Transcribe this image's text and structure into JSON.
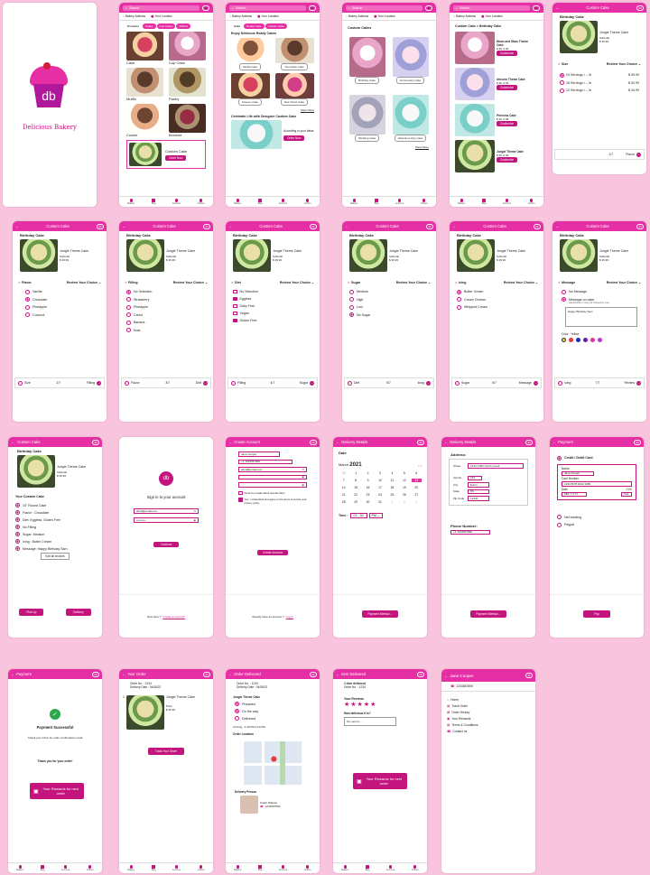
{
  "brand": {
    "initials": "db",
    "name": "Delicious Bakery"
  },
  "common": {
    "search": "Search",
    "bakery_address": "Bakery Address",
    "your_location": "Your Location",
    "nav": [
      "Bakery",
      "Bag",
      "Account",
      "Orders"
    ],
    "birthday_cake": "Birthday Cake",
    "custom_cake": "Custom Cake",
    "cake_name": "Jungle Theme Cake",
    "subtotal": "Subtotal",
    "price": "$ 39.99",
    "review": "Review Your Choice",
    "customize": "Customize"
  },
  "s2": {
    "chips": [
      "Products",
      "Cakes",
      "Cup Cakes",
      "Muffins"
    ],
    "items": [
      "Cake",
      "Cup Cake",
      "Muffin",
      "Pastry",
      "Cookie",
      "Brownie"
    ],
    "custom": "Custom Cake",
    "order_now": "Order Now"
  },
  "s3": {
    "chips": [
      "Cake",
      "Ready Cake",
      "Custom Cake"
    ],
    "heading": "Enjoy Delicious Ready Cakes",
    "items": [
      "Vanilla Cake",
      "Chocolate Cake",
      "Cheese Cake",
      "Red Velvet Cake"
    ],
    "show_more": "Show More",
    "heading2": "Celebrate Life with Designer Custom Cake",
    "desc": "According to your Ideas",
    "order_now": "Order Now"
  },
  "s4": {
    "heading": "Custom Cakes",
    "items": [
      "Birthday Cake",
      "Anniversary Cake",
      "Wedding Cake",
      "Valentines Day Cake"
    ],
    "show_more": "Show More"
  },
  "s5": {
    "crumb": "Custom Cake  >  Birthday Cake",
    "items": [
      {
        "name": "Moon and Stars Theme Cake",
        "price": "$ 39 .0 99"
      },
      {
        "name": "Unicorn Theme Cake",
        "price": "$ 39 .0 99"
      },
      {
        "name": "Princess Cake",
        "price": "$ 39 .0 99"
      },
      {
        "name": "Jungle Theme Cake",
        "price": "$ 39 .0 99"
      }
    ]
  },
  "s6": {
    "label": "Size",
    "sizes": [
      {
        "t": "24 Servings / -- lb",
        "p": "$ 59.99"
      },
      {
        "t": "16 Servings / -- lb",
        "p": "$ 52.99"
      },
      {
        "t": "12 Servings / -- lb",
        "p": "$ 44.99"
      }
    ],
    "step": "1/7",
    "next": "Flavor"
  },
  "s7": {
    "label": "Flavor",
    "opts": [
      "Vanilla",
      "Chocolate",
      "Pineapple",
      "Coconut"
    ],
    "prev": "Size",
    "step": "2/7",
    "next": "Filling"
  },
  "s8": {
    "label": "Filling",
    "opts": [
      "No Selection",
      "Strawberry",
      "Pineapple",
      "Carrot",
      "Banana",
      "Nuts"
    ],
    "prev": "Flavor",
    "step": "3/7",
    "next": "Diet"
  },
  "s9": {
    "label": "Diet",
    "opts": [
      "No Selection",
      "Eggless",
      "Dairy Free",
      "Vegan",
      "Gluten Free"
    ],
    "prev": "Filling",
    "step": "4/7",
    "next": "Sugar"
  },
  "s10": {
    "label": "Sugar",
    "opts": [
      "Medium",
      "High",
      "Low",
      "No Sugar"
    ],
    "prev": "Diet",
    "step": "5/7",
    "next": "Icing"
  },
  "s11": {
    "label": "Icing",
    "opts": [
      "Butter Cream",
      "Cream Cheese",
      "Whipped Cream"
    ],
    "prev": "Sugar",
    "step": "6/7",
    "next": "Message"
  },
  "s12": {
    "label": "Message",
    "opts": [
      "No Message",
      "Message on cake"
    ],
    "note": "Handwritten in icing 30 characters max",
    "msg": "Happy Birthday Sam",
    "color": "Color : Yellow",
    "colors": [
      "#f2d21f",
      "#e53a3a",
      "#1d2fa8",
      "#6a1bb0",
      "#e62fa4",
      "#b33ad0"
    ],
    "prev": "Icing",
    "step": "7/7",
    "next": "Review"
  },
  "s13": {
    "heading": "Your Custom Cake",
    "items": [
      "10\" Round Cake",
      "Flavor : Chocolate",
      "Diet: Eggless, Gluten Free",
      "No Filling",
      "Sugar: Medium",
      "Icing : Butter Cream",
      "Message: Happy Birthday Sam"
    ],
    "edit": "Edit all choices",
    "pick": "Pick Up",
    "delivery": "Delivery"
  },
  "s14": {
    "title": "Sign in to your account",
    "email": "abcd@email.com",
    "password": "••••••••••",
    "btn": "Continue",
    "new": "New here ?",
    "create": "Create an account"
  },
  "s15": {
    "title": "Create Account",
    "name": "Jane Cooper",
    "phone": "+1  1234567890",
    "email": "abcd@email.com",
    "c1": "Send me emails about special offers",
    "c2": "Yes, I understand and agree to the terms of service and privacy policy",
    "btn": "Create Account",
    "have": "Already have an account ?",
    "login": "Log in"
  },
  "s16": {
    "title": "Delivery Details",
    "date": "Date",
    "month": "March",
    "year": "2021",
    "days": [
      "29",
      "1",
      "2",
      "3",
      "4",
      "5",
      "6",
      "7",
      "8",
      "9",
      "10",
      "11",
      "12",
      "13",
      "14",
      "15",
      "16",
      "17",
      "18",
      "19",
      "20",
      "21",
      "22",
      "23",
      "24",
      "25",
      "26",
      "27",
      "28",
      "29",
      "30",
      "31",
      "1",
      "2",
      "3"
    ],
    "time": "Time :",
    "hh": "01",
    "mm": "30",
    "ampm": "PM",
    "btn": "Payment Method"
  },
  "s17": {
    "title": "Delivery Details",
    "address": "Address:",
    "street": "Street",
    "street_v": "1234 Griffin North Creek",
    "apt": "Apt No.",
    "apt_v": "123",
    "city": "City",
    "city_v": "Exton",
    "state": "State",
    "state_v": "PA",
    "zip": "Zip Code",
    "zip_v": "12340",
    "phone": "Phone Number:",
    "phone_v": "+1  1234567890",
    "btn": "Payment Method"
  },
  "s18": {
    "title": "Payment",
    "card": "Credit / Debit Card",
    "name": "Name",
    "name_v": "Jane Cooper",
    "num": "Card Number",
    "num_v": "1234 5678 9012 3456",
    "date": "Date",
    "date_v": "MM / YYYY",
    "cvv": "CVV",
    "cvv_v": "123",
    "net": "Net banking",
    "paypal": "Paypal",
    "btn": "Pay"
  },
  "s19": {
    "title": "Payment",
    "success": "Payment Successful",
    "check": "Check your inbox for order confirmation email",
    "thanks": "Thank you for your order!",
    "reward": "Your Rewards for next order"
  },
  "s20": {
    "title": "Your Order",
    "order": "Order No. : 1234",
    "delivery": "Delivery Date : 04/06/22",
    "qty": "1",
    "price": "Price",
    "btn": "Track Your Order"
  },
  "s21": {
    "title": "Order Delivered",
    "order": "Order No. : 1234",
    "delivery": "Delivery Date : 04/06/22",
    "cake": "Jungle Theme Cake",
    "steps": [
      "Prepared",
      "On the way",
      "Delivered"
    ],
    "arriving": "Arriving : 1:30 PM  1:20 PM",
    "loc": "Order Location",
    "person": "Delivery Person",
    "pname": "Kristin Watson",
    "pphone": "1234567890"
  },
  "s22": {
    "title": "Item Delivered",
    "deliv": "1 item delivered",
    "order": "Order No. : 1234",
    "reviews": "Your Reviews",
    "how": "How delicious it is?",
    "yummy": "So yummy....",
    "reward": "Your Rewards for next order"
  },
  "s23": {
    "name": "Jane Cooper",
    "phone": "1234567890",
    "menu": [
      "Home",
      "Track Order",
      "Order History",
      "Your Rewards",
      "Terms & Conditions",
      "Contact us"
    ]
  }
}
